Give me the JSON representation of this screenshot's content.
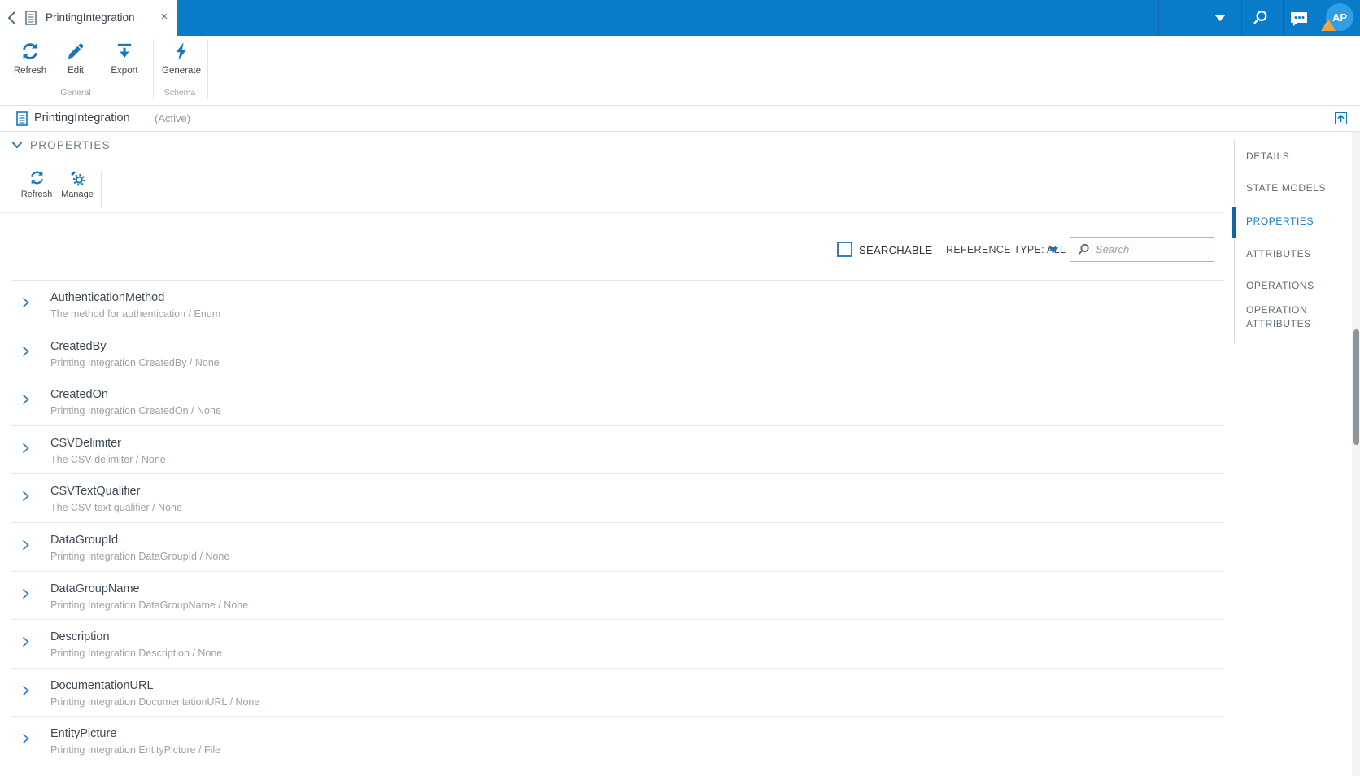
{
  "tab": {
    "title": "PrintingIntegration",
    "close": "×"
  },
  "topbar": {
    "avatar_initials": "AP",
    "warning_glyph": "!"
  },
  "toolbar": {
    "refresh": "Refresh",
    "edit": "Edit",
    "export": "Export",
    "generate": "Generate",
    "group_general": "General",
    "group_schema": "Schema"
  },
  "titlebar": {
    "name": "PrintingIntegration",
    "status": "(Active)"
  },
  "section": {
    "heading": "PROPERTIES",
    "refresh_label": "Refresh",
    "manage_label": "Manage"
  },
  "controls": {
    "searchable_label": "SEARCHABLE",
    "reference_type_label": "REFERENCE TYPE: ALL",
    "search_placeholder": "Search"
  },
  "properties_list": {
    "rows": [
      {
        "name": "AuthenticationMethod",
        "desc": "The method for authentication / Enum"
      },
      {
        "name": "CreatedBy",
        "desc": "Printing Integration CreatedBy / None"
      },
      {
        "name": "CreatedOn",
        "desc": "Printing Integration CreatedOn / None"
      },
      {
        "name": "CSVDelimiter",
        "desc": "The CSV delimiter / None"
      },
      {
        "name": "CSVTextQualifier",
        "desc": "The CSV text qualifier / None"
      },
      {
        "name": "DataGroupId",
        "desc": "Printing Integration DataGroupId / None"
      },
      {
        "name": "DataGroupName",
        "desc": "Printing Integration DataGroupName / None"
      },
      {
        "name": "Description",
        "desc": "Printing Integration Description / None"
      },
      {
        "name": "DocumentationURL",
        "desc": "Printing Integration DocumentationURL / None"
      },
      {
        "name": "EntityPicture",
        "desc": "Printing Integration EntityPicture / File"
      }
    ]
  },
  "nav": {
    "items": [
      {
        "label": "DETAILS"
      },
      {
        "label": "STATE MODELS"
      },
      {
        "label": "PROPERTIES"
      },
      {
        "label": "ATTRIBUTES"
      },
      {
        "label": "OPERATIONS"
      },
      {
        "label": "OPERATION ATTRIBUTES"
      }
    ]
  },
  "colors": {
    "topbar_blue": "#0a7bc8",
    "icon_blue": "#1577be",
    "avatar_blue": "#2e9fe6",
    "warning_orange": "#f0a13c",
    "text_dark": "#3d4954",
    "text_muted": "#9aa2aa",
    "divider": "#e4e6e9"
  }
}
